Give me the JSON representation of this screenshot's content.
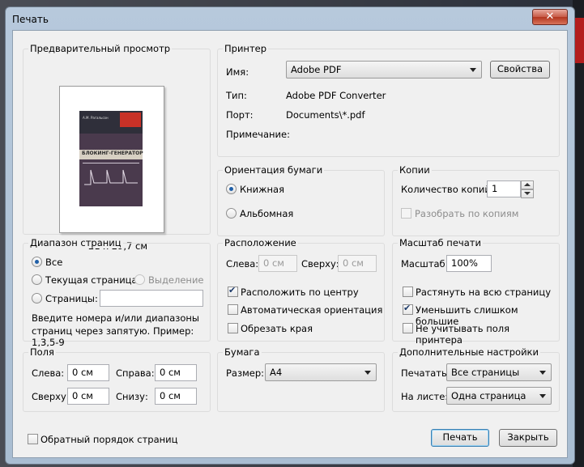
{
  "window": {
    "title": "Печать",
    "close_glyph": "✕"
  },
  "preview": {
    "label": "Предварительный просмотр",
    "page_size": "21 x 29,7 см",
    "book": {
      "author": "А.М. Рагальсон",
      "title": "БЛОКИНГ-ГЕНЕРАТОР"
    }
  },
  "printer": {
    "label": "Принтер",
    "name_label": "Имя:",
    "name_value": "Adobe PDF",
    "properties_button": "Свойства",
    "type_label": "Тип:",
    "type_value": "Adobe PDF Converter",
    "port_label": "Порт:",
    "port_value": "Documents\\*.pdf",
    "comment_label": "Примечание:",
    "comment_value": ""
  },
  "orientation": {
    "label": "Ориентация бумаги",
    "portrait": "Книжная",
    "landscape": "Альбомная",
    "selected": "portrait"
  },
  "copies": {
    "label": "Копии",
    "count_label": "Количество копий:",
    "count_value": "1",
    "collate_label": "Разобрать по копиям"
  },
  "page_range": {
    "label": "Диапазон страниц",
    "all": "Все",
    "current": "Текущая страница",
    "selection": "Выделение",
    "pages": "Страницы:",
    "pages_value": "",
    "hint": "Введите номера и/или диапазоны страниц через запятую. Пример: 1,3,5-9",
    "hint_line1": "Введите номера и/или диапазоны",
    "hint_line2": "страниц через запятую. Пример: 1,3,5-9"
  },
  "layout": {
    "label": "Расположение",
    "left_label": "Слева:",
    "left_value": "0 см",
    "top_label": "Сверху:",
    "top_value": "0 см",
    "center": "Расположить по центру",
    "auto_orient": "Автоматическая ориентация",
    "crop": "Обрезать края"
  },
  "scale": {
    "label": "Масштаб печати",
    "scale_label": "Масштаб:",
    "scale_value": "100%",
    "stretch": "Растянуть на всю страницу",
    "shrink": "Уменьшить слишком большие",
    "ignore_margins": "Не учитывать поля принтера"
  },
  "margins": {
    "label": "Поля",
    "left_label": "Слева:",
    "left_value": "0 см",
    "right_label": "Справа:",
    "right_value": "0 см",
    "top_label": "Сверху:",
    "top_value": "0 см",
    "bottom_label": "Снизу:",
    "bottom_value": "0 см"
  },
  "paper": {
    "label": "Бумага",
    "size_label": "Размер:",
    "size_value": "A4"
  },
  "advanced": {
    "label": "Дополнительные настройки",
    "print_label": "Печатать:",
    "print_value": "Все страницы",
    "sheet_label": "На листе:",
    "sheet_value": "Одна страница"
  },
  "footer": {
    "reverse_order": "Обратный порядок страниц",
    "print_button": "Печать",
    "close_button": "Закрыть"
  },
  "colors": {
    "title_bar": "#b7c9dc",
    "close_button": "#c75a46",
    "dialog_bg": "#f0f0f0",
    "accent": "#1f5fa8"
  }
}
